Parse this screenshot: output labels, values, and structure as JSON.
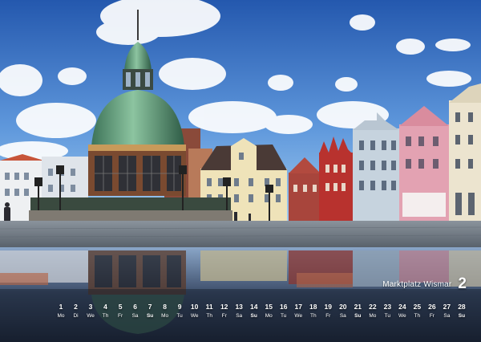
{
  "caption": {
    "place": "Marktplatz Wismar",
    "month_number": "2"
  },
  "calendar": {
    "days": [
      {
        "n": "1",
        "w": "Mo",
        "type": "weekday"
      },
      {
        "n": "2",
        "w": "Di",
        "type": "weekday"
      },
      {
        "n": "3",
        "w": "We",
        "type": "weekday"
      },
      {
        "n": "4",
        "w": "Th",
        "type": "weekday"
      },
      {
        "n": "5",
        "w": "Fr",
        "type": "weekday"
      },
      {
        "n": "6",
        "w": "Sa",
        "type": "sat"
      },
      {
        "n": "7",
        "w": "Su",
        "type": "sun"
      },
      {
        "n": "8",
        "w": "Mo",
        "type": "weekday"
      },
      {
        "n": "9",
        "w": "Tu",
        "type": "weekday"
      },
      {
        "n": "10",
        "w": "We",
        "type": "weekday"
      },
      {
        "n": "11",
        "w": "Th",
        "type": "weekday"
      },
      {
        "n": "12",
        "w": "Fr",
        "type": "weekday"
      },
      {
        "n": "13",
        "w": "Sa",
        "type": "sat"
      },
      {
        "n": "14",
        "w": "Su",
        "type": "sun"
      },
      {
        "n": "15",
        "w": "Mo",
        "type": "weekday"
      },
      {
        "n": "16",
        "w": "Tu",
        "type": "weekday"
      },
      {
        "n": "17",
        "w": "We",
        "type": "weekday"
      },
      {
        "n": "18",
        "w": "Th",
        "type": "weekday"
      },
      {
        "n": "19",
        "w": "Fr",
        "type": "weekday"
      },
      {
        "n": "20",
        "w": "Sa",
        "type": "sat"
      },
      {
        "n": "21",
        "w": "Su",
        "type": "sun"
      },
      {
        "n": "22",
        "w": "Mo",
        "type": "weekday"
      },
      {
        "n": "23",
        "w": "Tu",
        "type": "weekday"
      },
      {
        "n": "24",
        "w": "We",
        "type": "weekday"
      },
      {
        "n": "25",
        "w": "Th",
        "type": "weekday"
      },
      {
        "n": "26",
        "w": "Fr",
        "type": "weekday"
      },
      {
        "n": "27",
        "w": "Sa",
        "type": "sat"
      },
      {
        "n": "28",
        "w": "Su",
        "type": "sun"
      }
    ]
  },
  "colors": {
    "sky_top": "#2a62b8",
    "sky_bottom": "#8fc2ef",
    "dome_green": "#5d9a78",
    "pavement": "#6c7580"
  }
}
